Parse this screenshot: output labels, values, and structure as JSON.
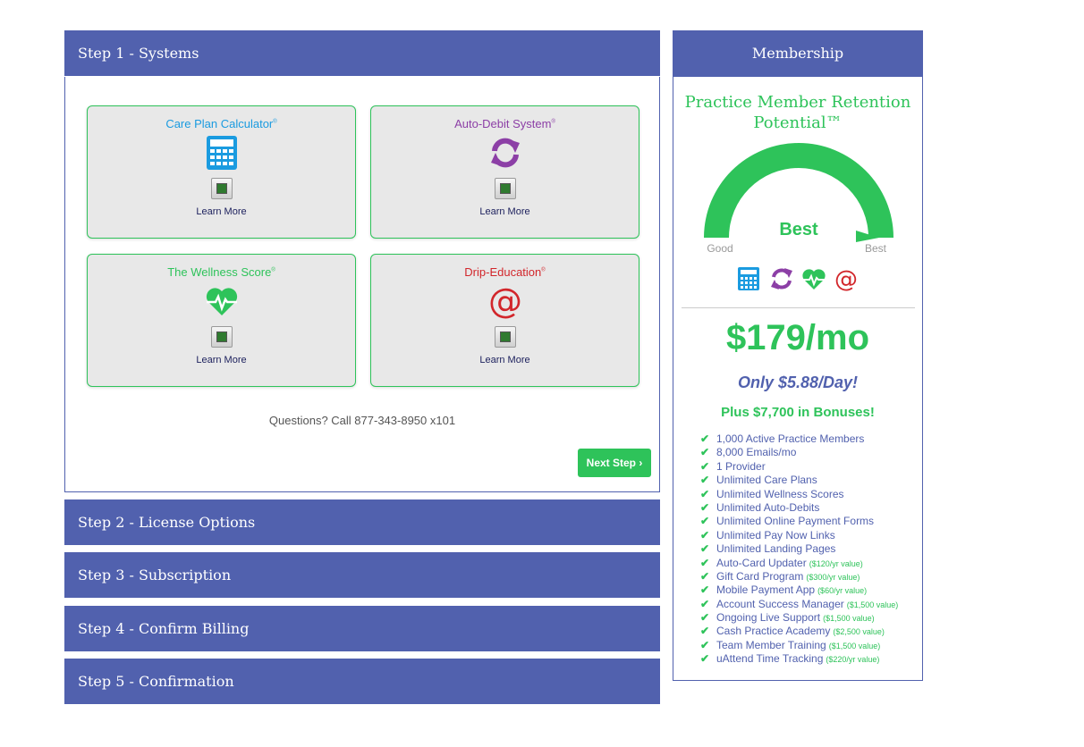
{
  "steps": [
    {
      "label": "Step 1 - Systems"
    },
    {
      "label": "Step 2 - License Options"
    },
    {
      "label": "Step 3 - Subscription"
    },
    {
      "label": "Step 4 - Confirm Billing"
    },
    {
      "label": "Step 5 - Confirmation"
    }
  ],
  "systems": {
    "cards": [
      {
        "title": "Care Plan Calculator",
        "mark": "®",
        "icon": "calculator-icon",
        "color": "#1a9be0",
        "learn": "Learn More"
      },
      {
        "title": "Auto-Debit System",
        "mark": "®",
        "icon": "refresh-icon",
        "color": "#8c3fa6",
        "learn": "Learn More"
      },
      {
        "title": "The Wellness Score",
        "mark": "®",
        "icon": "heart-pulse-icon",
        "color": "#2ec35a",
        "learn": "Learn More"
      },
      {
        "title": "Drip-Education",
        "mark": "®",
        "icon": "at-sign-icon",
        "color": "#d2262b",
        "learn": "Learn More"
      }
    ],
    "questions": "Questions? Call 877-343-8950 x101",
    "next_label": "Next Step ›"
  },
  "membership": {
    "header": "Membership",
    "retention_title_line1": "Practice Member Retention",
    "retention_title_line2": "Potential™",
    "gauge": {
      "level_label": "Best",
      "left_label": "Good",
      "right_label": "Best",
      "value_fraction": 1.0,
      "color": "#2ec35a"
    },
    "price": "$179/mo",
    "per_day": "Only $5.88/Day!",
    "bonuses": "Plus $7,700 in Bonuses!",
    "features": [
      {
        "text": "1,000 Active Practice Members",
        "value": ""
      },
      {
        "text": "8,000 Emails/mo",
        "value": ""
      },
      {
        "text": "1 Provider",
        "value": ""
      },
      {
        "text": "Unlimited Care Plans",
        "value": ""
      },
      {
        "text": "Unlimited Wellness Scores",
        "value": ""
      },
      {
        "text": "Unlimited Auto-Debits",
        "value": ""
      },
      {
        "text": "Unlimited Online Payment Forms",
        "value": ""
      },
      {
        "text": "Unlimited Pay Now Links",
        "value": ""
      },
      {
        "text": "Unlimited Landing Pages",
        "value": ""
      },
      {
        "text": "Auto-Card Updater",
        "value": "($120/yr value)"
      },
      {
        "text": "Gift Card Program",
        "value": "($300/yr value)"
      },
      {
        "text": "Mobile Payment App",
        "value": "($60/yr value)"
      },
      {
        "text": "Account Success Manager",
        "value": "($1,500 value)"
      },
      {
        "text": "Ongoing Live Support",
        "value": "($1,500 value)"
      },
      {
        "text": "Cash Practice Academy",
        "value": "($2,500 value)"
      },
      {
        "text": "Team Member Training",
        "value": "($1,500 value)"
      },
      {
        "text": "uAttend Time Tracking",
        "value": "($220/yr value)"
      }
    ]
  },
  "colors": {
    "primary": "#5161ae",
    "accent": "#2ec35a"
  }
}
